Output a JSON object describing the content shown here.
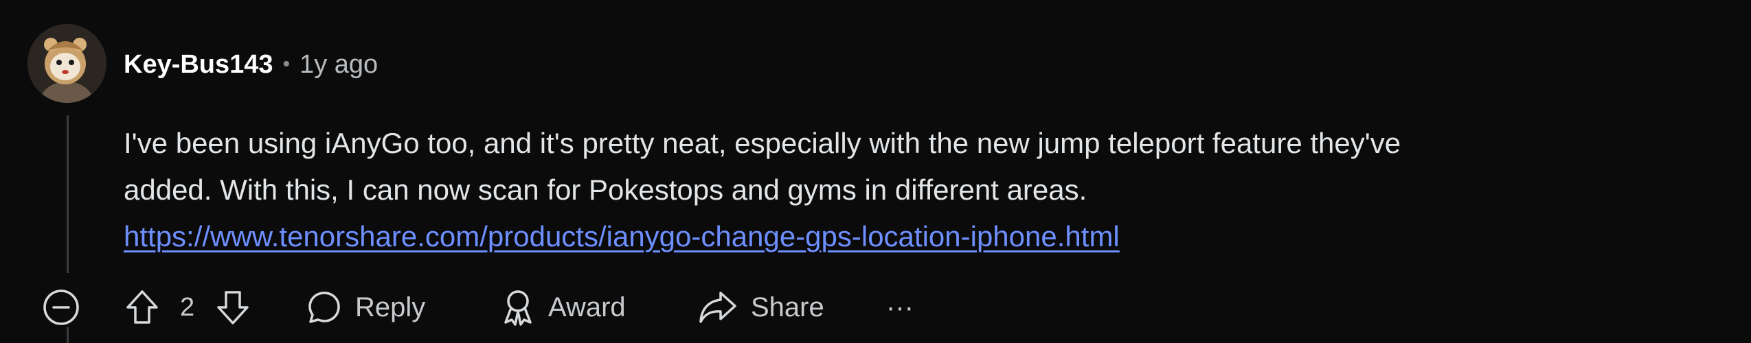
{
  "comment": {
    "username": "Key-Bus143",
    "separator": "•",
    "timestamp": "1y ago",
    "body_line_1": "I've been using iAnyGo too, and it's pretty neat, especially with the new jump teleport feature they've",
    "body_line_2": "added. With this, I can now scan for Pokestops and gyms in different areas.",
    "link_text": "https://www.tenorshare.com/products/ianygo-change-gps-location-iphone.html",
    "vote_count": "2"
  },
  "actions": {
    "reply_label": "Reply",
    "award_label": "Award",
    "share_label": "Share",
    "more_label": "···"
  },
  "icons": {
    "collapse": "collapse-minus-circle-icon",
    "upvote": "arrow-up-icon",
    "downvote": "arrow-down-icon",
    "reply": "speech-bubble-icon",
    "award": "award-ribbon-icon",
    "share": "share-arrow-icon"
  },
  "colors": {
    "background": "#0b0b0c",
    "link": "#6e8fff",
    "thread_line": "#3a3d40"
  }
}
